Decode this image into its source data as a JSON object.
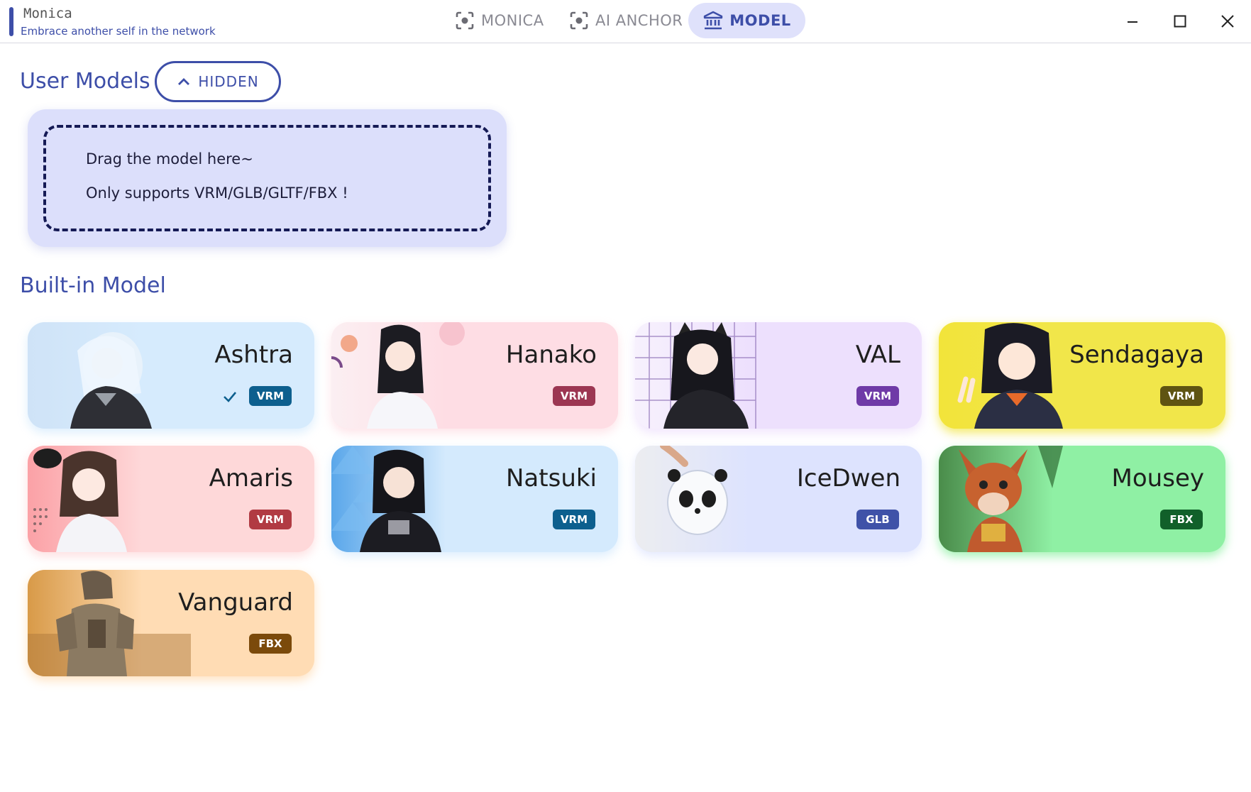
{
  "app": {
    "name": "Monica",
    "subtitle": "Embrace another self in the network"
  },
  "nav": {
    "tabs": [
      {
        "label": "MONICA",
        "icon": "focus-frame-icon",
        "active": false
      },
      {
        "label": "AI ANCHOR",
        "icon": "focus-frame-icon",
        "active": false
      },
      {
        "label": "MODEL",
        "icon": "bank-icon",
        "active": true
      }
    ]
  },
  "window_controls": [
    "minimize-icon",
    "maximize-icon",
    "close-icon"
  ],
  "user_models": {
    "title": "User Models",
    "toggle_label": "HIDDEN",
    "drop_line_1": "Drag the model here~",
    "drop_line_2": "Only supports VRM/GLB/GLTF/FBX !"
  },
  "builtin": {
    "title": "Built-in Model",
    "models": [
      {
        "name": "Ashtra",
        "format": "VRM",
        "selected": true,
        "bg": "#d6ebfd",
        "badge_color": "#0d5f8e"
      },
      {
        "name": "Hanako",
        "format": "VRM",
        "selected": false,
        "bg": "#fedde4",
        "badge_color": "#9c3652"
      },
      {
        "name": "VAL",
        "format": "VRM",
        "selected": false,
        "bg": "#ede0fd",
        "badge_color": "#6f3aa7"
      },
      {
        "name": "Sendagaya",
        "format": "VRM",
        "selected": false,
        "bg": "#f1e64a",
        "badge_color": "#5f5412"
      },
      {
        "name": "Amaris",
        "format": "VRM",
        "selected": false,
        "bg": "#fed8d9",
        "badge_color": "#b13b43"
      },
      {
        "name": "Natsuki",
        "format": "VRM",
        "selected": false,
        "bg": "#d4eafd",
        "badge_color": "#0d5f8e"
      },
      {
        "name": "IceDwen",
        "format": "GLB",
        "selected": false,
        "bg": "#dde3fe",
        "badge_color": "#3f52a8"
      },
      {
        "name": "Mousey",
        "format": "FBX",
        "selected": false,
        "bg": "#8ff0a4",
        "badge_color": "#11602a"
      },
      {
        "name": "Vanguard",
        "format": "FBX",
        "selected": false,
        "bg": "#ffdcb4",
        "badge_color": "#7b4a0b"
      }
    ]
  }
}
